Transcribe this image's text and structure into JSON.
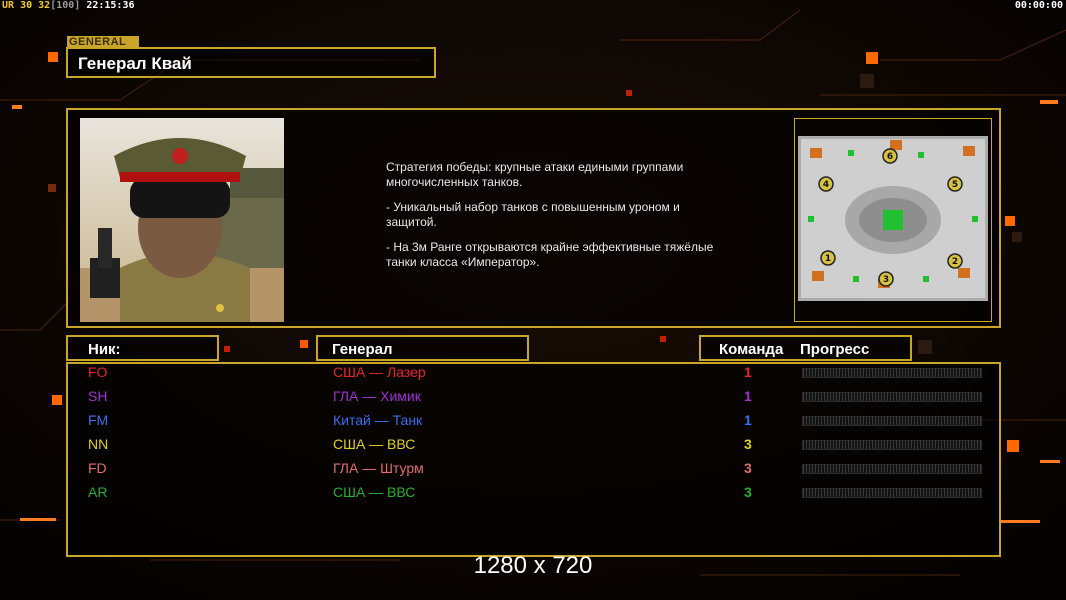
{
  "hud": {
    "tag": "UR",
    "fps": "30 32",
    "fps_cap": "[100]",
    "clock": "22:15:36",
    "timer": "00:00:00"
  },
  "general": {
    "section_label": "GENERAL",
    "name": "Генерал Квай",
    "description": [
      "Стратегия победы: крупные атаки едиными группами многочисленных танков.",
      "- Уникальный набор танков с повышенным уроном и защитой.",
      "- На 3м Ранге открываются крайне эффективные тяжёлые танки класса «Император»."
    ]
  },
  "map": {
    "slots": [
      "1",
      "2",
      "3",
      "4",
      "5",
      "6"
    ]
  },
  "columns": {
    "nick": "Ник:",
    "general": "Генерал",
    "team": "Команда",
    "progress": "Прогресс"
  },
  "players": [
    {
      "nick": "FO",
      "general": "США — Лазер",
      "team": "1",
      "color": "#e8242a",
      "progress": 0.0
    },
    {
      "nick": "SH",
      "general": "ГЛА — Химик",
      "team": "1",
      "color": "#a030d8",
      "progress": 0.0
    },
    {
      "nick": "FM",
      "general": "Китай — Танк",
      "team": "1",
      "color": "#3a6ef0",
      "progress": 0.0
    },
    {
      "nick": "NN",
      "general": "США — ВВС",
      "team": "3",
      "color": "#e0d020",
      "progress": 0.0
    },
    {
      "nick": "FD",
      "general": "ГЛА — Штурм",
      "team": "3",
      "color": "#e0706a",
      "progress": 0.0
    },
    {
      "nick": "AR",
      "general": "США — ВВС",
      "team": "3",
      "color": "#28b030",
      "progress": 0.0
    }
  ],
  "resolution_label": "1280 x 720",
  "colors": {
    "frame": "#c9a52a",
    "accent": "#ff6a00"
  }
}
